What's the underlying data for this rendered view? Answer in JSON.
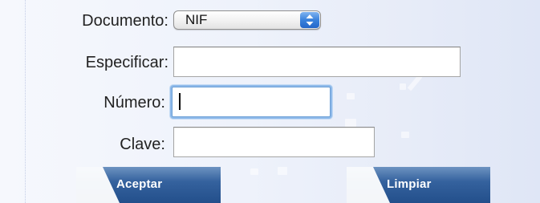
{
  "form": {
    "document_label": "Documento:",
    "document_value": "NIF",
    "specify_label": "Especificar:",
    "specify_value": "",
    "number_label": "Número:",
    "number_value": "",
    "key_label": "Clave:",
    "key_value": ""
  },
  "buttons": {
    "accept_label": "Aceptar",
    "clear_label": "Limpiar"
  },
  "colors": {
    "button_blue": "#2b5b98",
    "focus_ring": "#8fbaea",
    "select_arrow_blue": "#3a82dc",
    "panel_background": "#eef2fb"
  },
  "icons": {
    "select_arrows": "up-down-arrows-icon"
  }
}
